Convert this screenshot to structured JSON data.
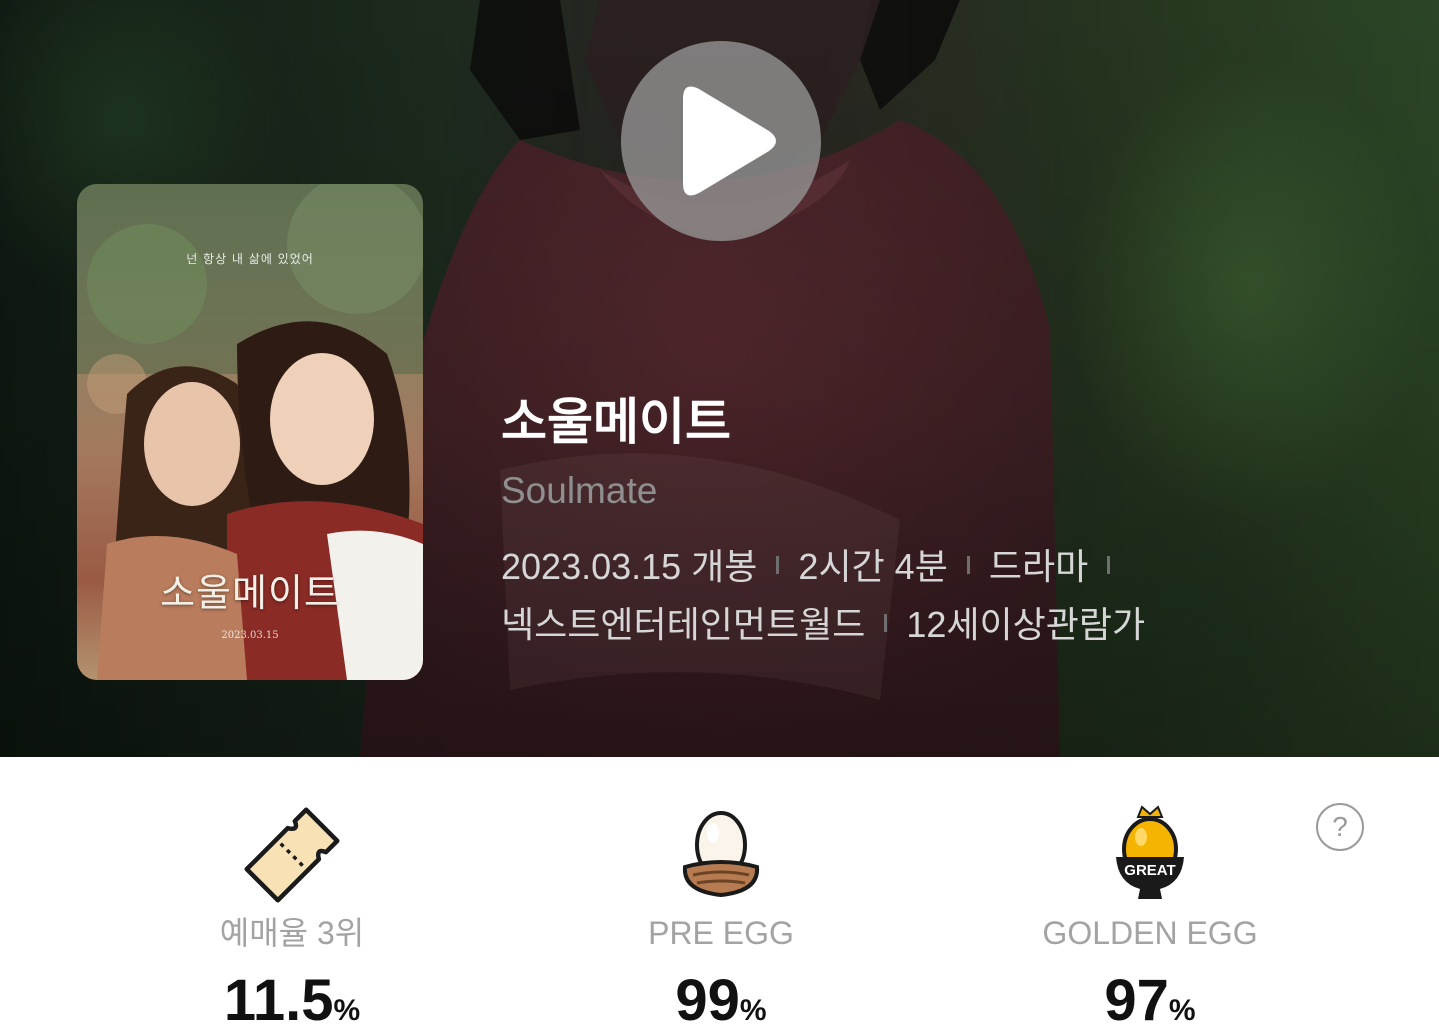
{
  "hero": {
    "play_icon": "play-icon",
    "poster": {
      "tagline": "넌 항상 내 삶에 있었어",
      "title": "소울메이트",
      "date": "2023.03.15"
    },
    "title": "소울메이트",
    "subtitle": "Soulmate",
    "meta": {
      "release": "2023.03.15 개봉",
      "runtime": "2시간 4분",
      "genre": "드라마",
      "distributor": "넥스트엔터테인먼트월드",
      "rating": "12세이상관람가"
    }
  },
  "stats": {
    "items": [
      {
        "icon": "ticket-icon",
        "label": "예매율 3위",
        "value": "11.5",
        "unit": "%"
      },
      {
        "icon": "egg-nest-icon",
        "label": "PRE EGG",
        "value": "99",
        "unit": "%"
      },
      {
        "icon": "golden-egg-icon",
        "label": "GOLDEN EGG",
        "value": "97",
        "unit": "%",
        "badge": "GREAT"
      }
    ],
    "help_icon": "help-icon",
    "help_label": "?"
  },
  "colors": {
    "title": "#ffffff",
    "subtitle": "#8f8f8f",
    "meta": "#d6d6d6",
    "stat_label": "#a3a3a3",
    "stat_value": "#111111",
    "golden_egg": "#f5b400"
  }
}
